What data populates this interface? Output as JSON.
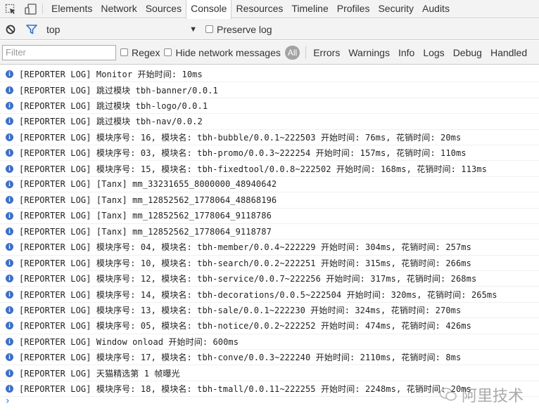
{
  "tabbar": {
    "tabs": [
      "Elements",
      "Network",
      "Sources",
      "Console",
      "Resources",
      "Timeline",
      "Profiles",
      "Security",
      "Audits"
    ],
    "active_tab": "Console"
  },
  "context": {
    "selected": "top",
    "preserve_log_label": "Preserve log"
  },
  "filter": {
    "placeholder": "Filter",
    "regex_label": "Regex",
    "hide_network_label": "Hide network messages",
    "all_label": "All",
    "levels": [
      "Errors",
      "Warnings",
      "Info",
      "Logs",
      "Debug",
      "Handled"
    ]
  },
  "messages": [
    "[REPORTER LOG] Monitor 开始时间: 10ms",
    "[REPORTER LOG] 跳过模块 tbh-banner/0.0.1",
    "[REPORTER LOG] 跳过模块 tbh-logo/0.0.1",
    "[REPORTER LOG] 跳过模块 tbh-nav/0.0.2",
    "[REPORTER LOG] 模块序号: 16, 模块名: tbh-bubble/0.0.1~222503 开始时间: 76ms, 花销时间: 20ms",
    "[REPORTER LOG] 模块序号: 03, 模块名: tbh-promo/0.0.3~222254 开始时间: 157ms, 花销时间: 110ms",
    "[REPORTER LOG] 模块序号: 15, 模块名: tbh-fixedtool/0.0.8~222502 开始时间: 168ms, 花销时间: 113ms",
    "[REPORTER LOG] [Tanx] mm_33231655_8000000_48940642",
    "[REPORTER LOG] [Tanx] mm_12852562_1778064_48868196",
    "[REPORTER LOG] [Tanx] mm_12852562_1778064_9118786",
    "[REPORTER LOG] [Tanx] mm_12852562_1778064_9118787",
    "[REPORTER LOG] 模块序号: 04, 模块名: tbh-member/0.0.4~222229 开始时间: 304ms, 花销时间: 257ms",
    "[REPORTER LOG] 模块序号: 10, 模块名: tbh-search/0.0.2~222251 开始时间: 315ms, 花销时间: 266ms",
    "[REPORTER LOG] 模块序号: 12, 模块名: tbh-service/0.0.7~222256 开始时间: 317ms, 花销时间: 268ms",
    "[REPORTER LOG] 模块序号: 14, 模块名: tbh-decorations/0.0.5~222504 开始时间: 320ms, 花销时间: 265ms",
    "[REPORTER LOG] 模块序号: 13, 模块名: tbh-sale/0.0.1~222230 开始时间: 324ms, 花销时间: 270ms",
    "[REPORTER LOG] 模块序号: 05, 模块名: tbh-notice/0.0.2~222252 开始时间: 474ms, 花销时间: 426ms",
    "[REPORTER LOG] Window onload 开始时间: 600ms",
    "[REPORTER LOG] 模块序号: 17, 模块名: tbh-conve/0.0.3~222240 开始时间: 2110ms, 花销时间: 8ms",
    "[REPORTER LOG] 天猫精选第 1 帧曝光",
    "[REPORTER LOG] 模块序号: 18, 模块名: tbh-tmall/0.0.11~222255 开始时间: 2248ms, 花销时间: 20ms"
  ],
  "watermark": "阿里技术",
  "colors": {
    "toolbar_bg": "#f3f3f3",
    "info_icon": "#3b6fc9",
    "prompt": "#2a72d8",
    "filter_icon": "#2a72d8"
  }
}
